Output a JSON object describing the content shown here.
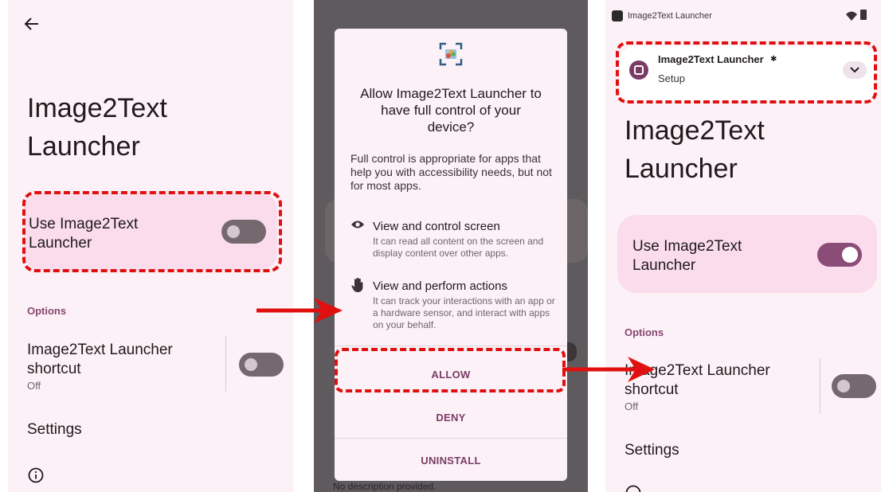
{
  "panel1": {
    "app_title": "Image2Text Launcher",
    "use_label": "Use Image2Text Launcher",
    "use_state": "off",
    "options_header": "Options",
    "shortcut_label": "Image2Text Launcher shortcut",
    "shortcut_status": "Off",
    "settings_label": "Settings",
    "icons": [
      "back-arrow-icon",
      "info-icon"
    ]
  },
  "dialog": {
    "title": "Allow Image2Text Launcher to have full control of your device?",
    "body": "Full control is appropriate for apps that help you with accessibility needs, but not for most apps.",
    "permissions": [
      {
        "icon": "eye-icon",
        "title": "View and control screen",
        "desc": "It can read all content on the screen and display content over other apps."
      },
      {
        "icon": "hand-icon",
        "title": "View and perform actions",
        "desc": "It can track your interactions with an app or a hardware sensor, and interact with apps on your behalf."
      }
    ],
    "allow_label": "ALLOW",
    "deny_label": "DENY",
    "uninstall_label": "UNINSTALL",
    "background_text": "No description provided."
  },
  "panel3": {
    "statusbar_title": "Image2Text Launcher",
    "notification": {
      "app": "Image2Text Launcher",
      "text": "Setup"
    },
    "app_title": "Image2Text Launcher",
    "use_label": "Use Image2Text Launcher",
    "use_state": "on",
    "options_header": "Options",
    "shortcut_label": "Image2Text Launcher shortcut",
    "shortcut_status": "Off",
    "settings_label": "Settings"
  },
  "colors": {
    "highlight": "#e01010",
    "accent": "#8b4c78",
    "panel_bg": "#fcf1f6"
  }
}
